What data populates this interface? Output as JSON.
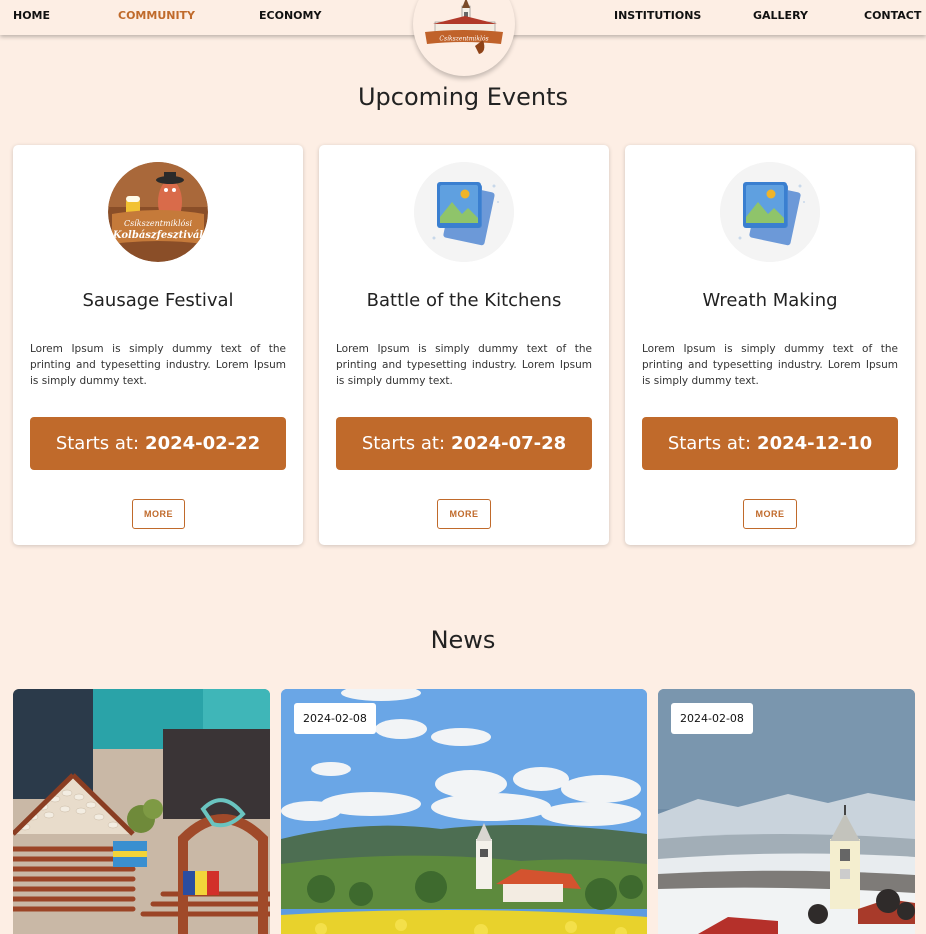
{
  "nav": {
    "items": [
      {
        "label": "HOME",
        "active": false
      },
      {
        "label": "COMMUNITY",
        "active": true
      },
      {
        "label": "ECONOMY",
        "active": false
      },
      {
        "label": "INSTITUTIONS",
        "active": false
      },
      {
        "label": "GALLERY",
        "active": false
      },
      {
        "label": "CONTACT",
        "active": false
      }
    ],
    "logo": {
      "banner_text": "Csíkszentmiklós",
      "icon": "church-logo-icon"
    }
  },
  "events": {
    "title": "Upcoming Events",
    "cards": [
      {
        "title": "Sausage Festival",
        "thumbnail": "sausage-festival-logo",
        "thumbnail_text_line1": "Csíkszentmiklósi",
        "thumbnail_text_line2": "Kolbászfesztivál",
        "description": "Lorem Ipsum is simply dummy text of the printing and typesetting industry. Lorem Ipsum is simply dummy text.",
        "starts_label": "Starts at:",
        "date": "2024-02-22",
        "more_label": "MORE"
      },
      {
        "title": "Battle of the Kitchens",
        "thumbnail": "image-placeholder-icon",
        "description": "Lorem Ipsum is simply dummy text of the printing and typesetting industry. Lorem Ipsum is simply dummy text.",
        "starts_label": "Starts at:",
        "date": "2024-07-28",
        "more_label": "MORE"
      },
      {
        "title": "Wreath Making",
        "thumbnail": "image-placeholder-icon",
        "description": "Lorem Ipsum is simply dummy text of the printing and typesetting industry. Lorem Ipsum is simply dummy text.",
        "starts_label": "Starts at:",
        "date": "2024-12-10",
        "more_label": "MORE"
      }
    ]
  },
  "news": {
    "title": "News",
    "items": [
      {
        "image": "sausage-house-photo"
      },
      {
        "image": "village-summer-photo",
        "date": "2024-02-08"
      },
      {
        "image": "village-winter-photo",
        "date": "2024-02-08"
      }
    ]
  },
  "colors": {
    "accent": "#c06a2b",
    "background": "#fdeee4",
    "card": "#ffffff"
  }
}
